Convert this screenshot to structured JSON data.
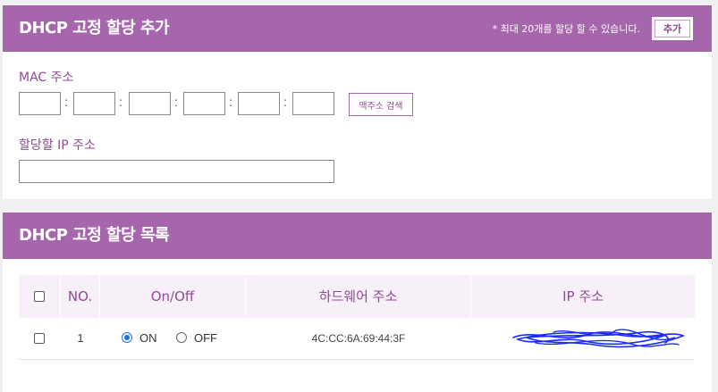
{
  "add_section": {
    "title": "DHCP 고정 할당 추가",
    "note": "* 최대 20개를 할당 할 수 있습니다.",
    "add_button": "추가",
    "mac_label": "MAC 주소",
    "mac_separator": ":",
    "mac_search_button": "맥주소 검색",
    "ip_label": "할당할 IP 주소",
    "mac_values": [
      "",
      "",
      "",
      "",
      "",
      ""
    ],
    "ip_value": ""
  },
  "list_section": {
    "title": "DHCP 고정 할당 목록",
    "columns": [
      "NO.",
      "On/Off",
      "하드웨어 주소",
      "IP 주소"
    ],
    "rows": [
      {
        "no": "1",
        "on_label": "ON",
        "off_label": "OFF",
        "state": "ON",
        "mac": "4C:CC:6A:69:44:3F",
        "ip": "(redacted)"
      }
    ]
  },
  "colors": {
    "header": "#a566ab",
    "accent_text": "#8f4a96",
    "table_header_bg": "#f7f0f8",
    "radio_selected": "#1a73e8",
    "redaction_scribble": "#1a2bff"
  }
}
